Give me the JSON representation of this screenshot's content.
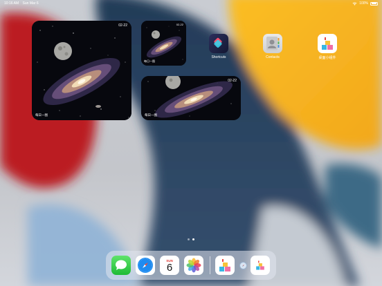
{
  "status_bar": {
    "time": "10:16 AM",
    "date": "Sun Mar 6",
    "battery_text": "100%",
    "battery_level": 1.0,
    "icons": [
      "wifi-icon",
      "battery-icon"
    ]
  },
  "widgets": {
    "large": {
      "date": "02-22",
      "label": "每日一图"
    },
    "small": {
      "date": "02-22",
      "label": "每日一图"
    },
    "medium": {
      "date": "02-22",
      "label": "每日一图"
    }
  },
  "apps": [
    {
      "name": "Shortcuts",
      "icon": "shortcuts-icon"
    },
    {
      "name": "Contacts",
      "icon": "contacts-icon"
    },
    {
      "name": "桌面小组件",
      "icon": "desktop-widget-icon"
    }
  ],
  "page_indicator": {
    "pages": 2,
    "current": 2
  },
  "dock": {
    "apps": [
      "messages-icon",
      "safari-icon",
      "calendar-icon",
      "photos-icon"
    ],
    "calendar": {
      "day": "SUN",
      "date": "6"
    },
    "recent": [
      "desktop-widget-icon",
      "safari-icon",
      "desktop-widget-icon"
    ]
  }
}
